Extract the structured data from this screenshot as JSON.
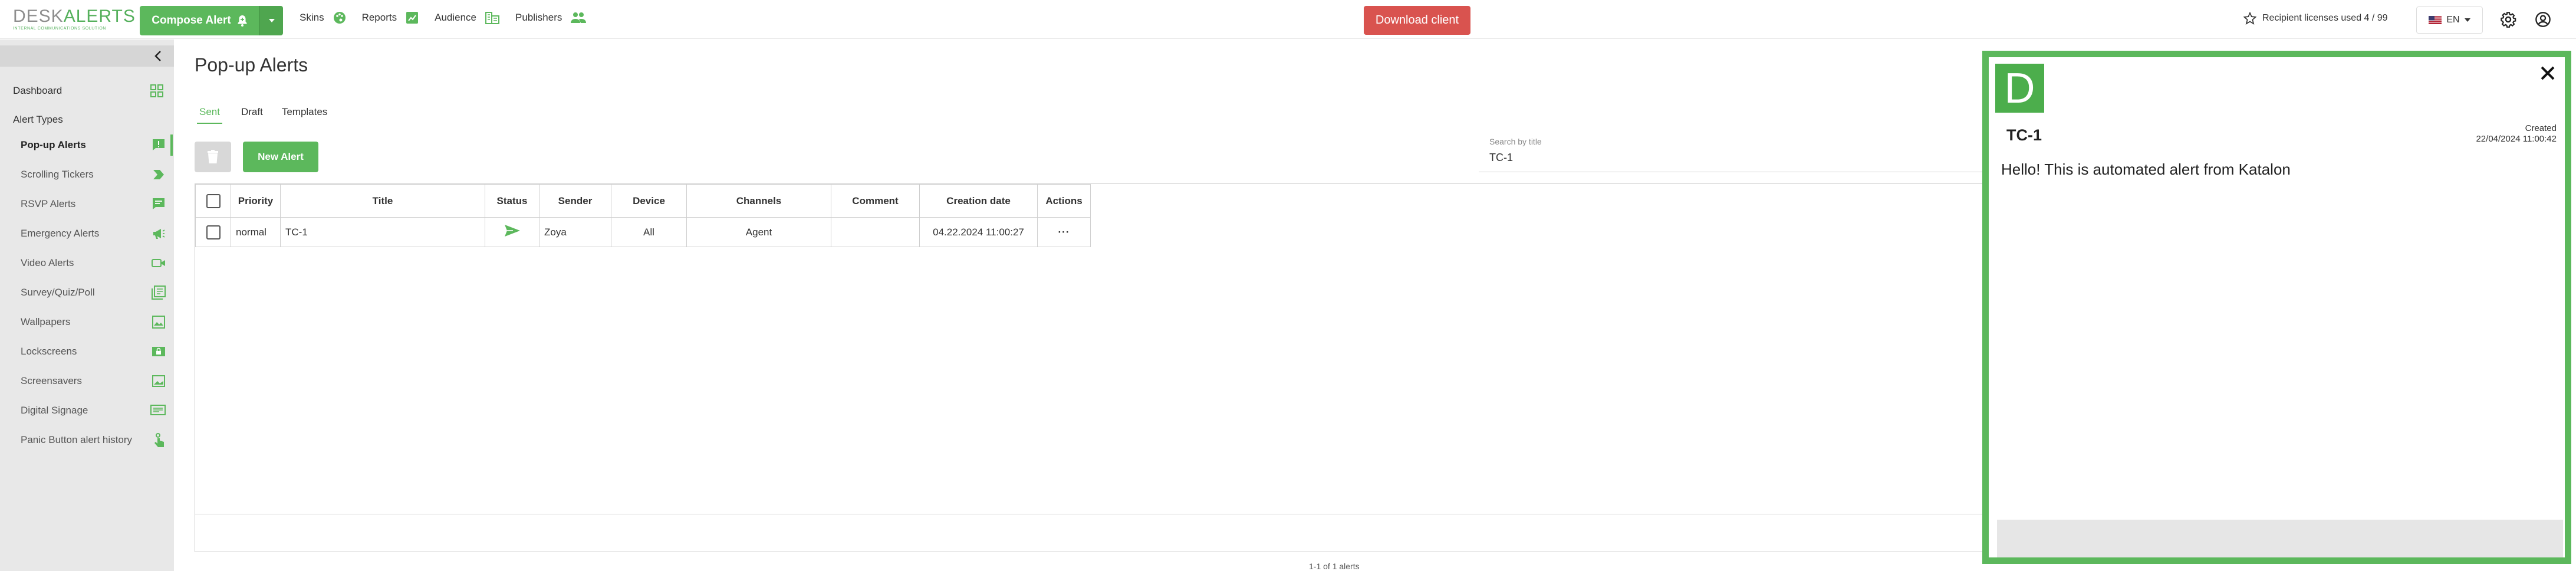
{
  "topbar": {
    "logo_desk": "DESK",
    "logo_alerts": "ALERTS",
    "logo_tagline": "INTERNAL COMMUNICATIONS SOLUTION",
    "compose_label": "Compose Alert",
    "nav": [
      "Skins",
      "Reports",
      "Audience",
      "Publishers"
    ],
    "download_label": "Download client",
    "licenses_text": "Recipient licenses used 4 / 99",
    "language": "EN"
  },
  "sidebar": {
    "dashboard_label": "Dashboard",
    "section_label": "Alert Types",
    "items": [
      {
        "label": "Pop-up Alerts",
        "icon": "popup-alert-icon",
        "active": true
      },
      {
        "label": "Scrolling Tickers",
        "icon": "ticker-icon",
        "active": false
      },
      {
        "label": "RSVP Alerts",
        "icon": "rsvp-icon",
        "active": false
      },
      {
        "label": "Emergency Alerts",
        "icon": "megaphone-icon",
        "active": false
      },
      {
        "label": "Video Alerts",
        "icon": "video-icon",
        "active": false
      },
      {
        "label": "Survey/Quiz/Poll",
        "icon": "survey-icon",
        "active": false
      },
      {
        "label": "Wallpapers",
        "icon": "wallpaper-icon",
        "active": false
      },
      {
        "label": "Lockscreens",
        "icon": "lockscreen-icon",
        "active": false
      },
      {
        "label": "Screensavers",
        "icon": "screensaver-icon",
        "active": false
      },
      {
        "label": "Digital Signage",
        "icon": "signage-icon",
        "active": false
      },
      {
        "label": "Panic Button alert history",
        "icon": "panic-hand-icon",
        "active": false
      }
    ]
  },
  "main": {
    "title": "Pop-up Alerts",
    "tabs": [
      {
        "label": "Sent",
        "active": true
      },
      {
        "label": "Draft",
        "active": false
      },
      {
        "label": "Templates",
        "active": false
      }
    ],
    "new_alert_label": "New Alert",
    "search_label": "Search by title",
    "search_value": "TC-1",
    "table": {
      "headers": [
        "Priority",
        "Title",
        "Status",
        "Sender",
        "Device",
        "Channels",
        "Comment",
        "Creation date",
        "Actions"
      ],
      "rows": [
        {
          "priority": "normal",
          "title": "TC-1",
          "status": "sent-icon",
          "sender": "Zoya",
          "device": "All",
          "channels": "Agent",
          "comment": "",
          "creation_date": "04.22.2024 11:00:27",
          "actions": "···"
        }
      ]
    },
    "pager_text": "1-1 of 1 alerts"
  },
  "popup": {
    "logo_letter": "D",
    "title": "TC-1",
    "created_label": "Created",
    "created_value": "22/04/2024 11:00:42",
    "body": "Hello! This is automated alert from Katalon"
  },
  "colors": {
    "accent": "#5cb85c",
    "danger": "#d9534f",
    "sidebar_bg": "#e8e8e8"
  }
}
